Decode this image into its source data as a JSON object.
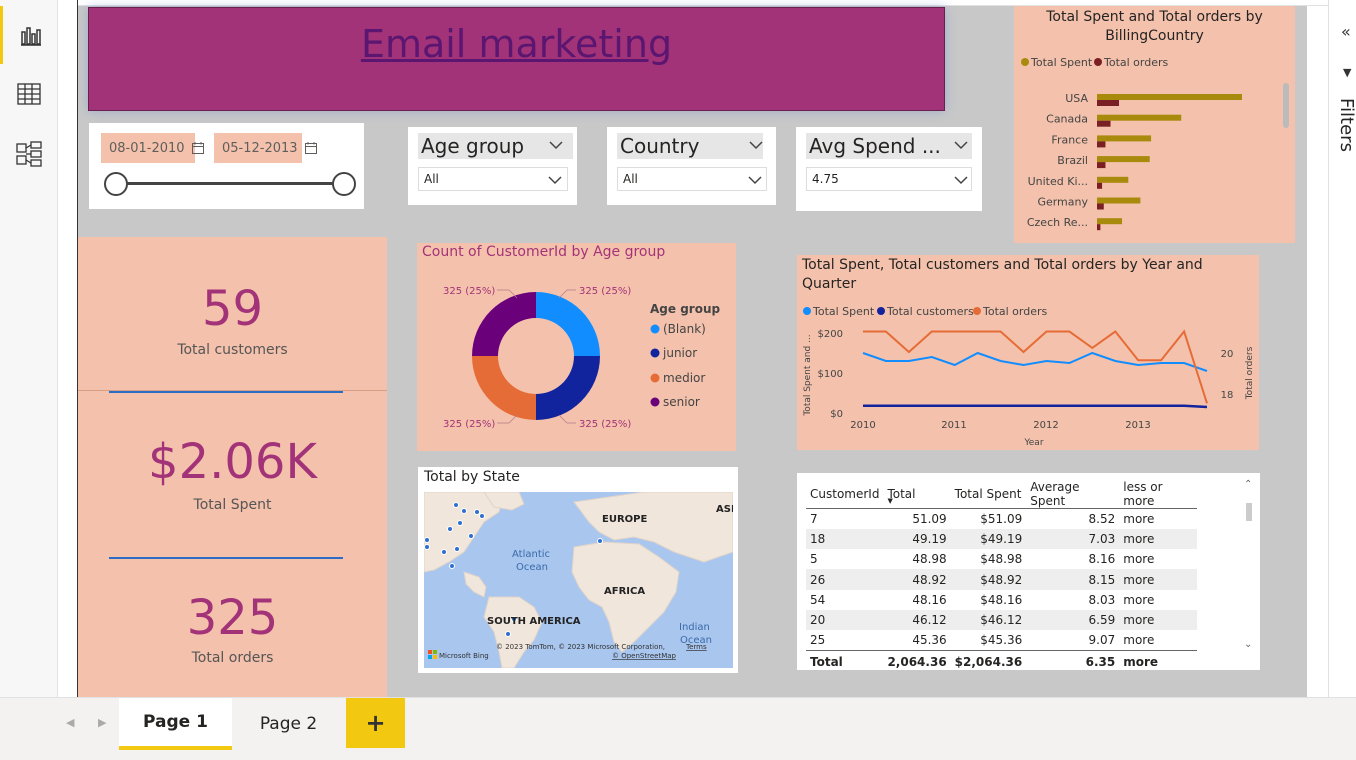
{
  "app": {
    "accent": "#f2c811",
    "canvas_bg": "#c8c8c8",
    "panel_bg": "#f4c2ac",
    "title_bg": "#a33378"
  },
  "left_rail": {
    "items": [
      "report-view-icon",
      "table-view-icon",
      "model-view-icon"
    ]
  },
  "title": {
    "text": "Email marketing "
  },
  "date_slicer": {
    "start": "08-01-2010",
    "end": "05-12-2013"
  },
  "slicers": [
    {
      "header": "Age group",
      "value": "All"
    },
    {
      "header": "Country",
      "value": "All"
    },
    {
      "header": "Avg Spend ...",
      "value": "4.75"
    }
  ],
  "kpis": [
    {
      "value": "59",
      "label": "Total customers"
    },
    {
      "value": "$2.06K",
      "label": "Total Spent"
    },
    {
      "value": "325",
      "label": "Total orders"
    }
  ],
  "donut": {
    "title": "Count of CustomerId by Age group",
    "legend_title": "Age group",
    "slice_labels": [
      "325 (25%)",
      "325 (25%)",
      "325 (25%)",
      "325 (25%)"
    ],
    "legend": [
      "(Blank)",
      "junior",
      "medior",
      "senior"
    ]
  },
  "map": {
    "title": "Total by State",
    "labels": [
      "EUROPE",
      "ASI",
      "Atlantic",
      "Ocean",
      "AFRICA",
      "SOUTH AMERICA",
      "Indian",
      "Ocean"
    ],
    "brand": "Microsoft Bing",
    "copyright": "© 2023 TomTom, © 2023 Microsoft Corporation,",
    "terms": "Terms",
    "osm": "© OpenStreetMap"
  },
  "line_chart_title": "Total Spent, Total customers and Total orders by Year and Quarter",
  "bar_chart_title": "Total Spent and Total orders by BillingCountry",
  "chart_data": [
    {
      "type": "bar",
      "title": "Total Spent and Total orders by BillingCountry",
      "categories": [
        "USA",
        "Canada",
        "France",
        "Brazil",
        "United Ki...",
        "Germany",
        "Czech Re..."
      ],
      "series": [
        {
          "name": "Total Spent",
          "values": [
            523.06,
            303.96,
            195.1,
            190.1,
            112.86,
            156.48,
            90.24
          ]
        },
        {
          "name": "Total orders",
          "values": [
            91,
            56,
            35,
            35,
            21,
            28,
            14
          ]
        }
      ],
      "colors": [
        "#a88a0c",
        "#7a1f23"
      ]
    },
    {
      "type": "pie",
      "title": "Count of CustomerId by Age group",
      "categories": [
        "(Blank)",
        "junior",
        "medior",
        "senior"
      ],
      "values": [
        325,
        325,
        325,
        325
      ],
      "colors": [
        "#118dff",
        "#12239e",
        "#e66c37",
        "#6b007b"
      ]
    },
    {
      "type": "line",
      "title": "Total Spent, Total customers and Total orders by Year and Quarter",
      "x": [
        "2010 Q1",
        "2010 Q2",
        "2010 Q3",
        "2010 Q4",
        "2011 Q1",
        "2011 Q2",
        "2011 Q3",
        "2011 Q4",
        "2012 Q1",
        "2012 Q2",
        "2012 Q3",
        "2012 Q4",
        "2013 Q1",
        "2013 Q2",
        "2013 Q3",
        "2013 Q4"
      ],
      "x_ticks": [
        "2010",
        "2011",
        "2012",
        "2013"
      ],
      "xlabel": "Year",
      "ylabel": "Total Spent and ...",
      "y2label": "Total orders",
      "y_ticks": [
        "$200",
        "$100",
        "$0"
      ],
      "y2_ticks": [
        "20",
        "18"
      ],
      "series": [
        {
          "name": "Total Spent",
          "axis": "left",
          "values": [
            150,
            130,
            130,
            140,
            120,
            150,
            130,
            120,
            130,
            125,
            150,
            130,
            120,
            125,
            125,
            105
          ]
        },
        {
          "name": "Total customers",
          "axis": "left",
          "values": [
            18,
            18,
            18,
            18,
            18,
            18,
            18,
            18,
            18,
            18,
            18,
            18,
            18,
            18,
            18,
            15
          ]
        },
        {
          "name": "Total orders",
          "axis": "right",
          "values": [
            21,
            21,
            20,
            21,
            21,
            21,
            21,
            20,
            21,
            21,
            20.2,
            21,
            19.6,
            19.6,
            21,
            17.5
          ]
        }
      ],
      "colors": [
        "#118dff",
        "#12239e",
        "#e66c37"
      ]
    }
  ],
  "table": {
    "headers": [
      "CustomerId",
      "Total",
      "Total Spent",
      "Average Spent",
      "less or more"
    ],
    "rows": [
      [
        "7",
        "51.09",
        "$51.09",
        "8.52",
        "more"
      ],
      [
        "18",
        "49.19",
        "$49.19",
        "7.03",
        "more"
      ],
      [
        "5",
        "48.98",
        "$48.98",
        "8.16",
        "more"
      ],
      [
        "26",
        "48.92",
        "$48.92",
        "8.15",
        "more"
      ],
      [
        "54",
        "48.16",
        "$48.16",
        "8.03",
        "more"
      ],
      [
        "20",
        "46.12",
        "$46.12",
        "6.59",
        "more"
      ],
      [
        "25",
        "45.36",
        "$45.36",
        "9.07",
        "more"
      ]
    ],
    "total": [
      "Total",
      "2,064.36",
      "$2,064.36",
      "6.35",
      "more"
    ]
  },
  "pages": {
    "tabs": [
      "Page 1",
      "Page 2"
    ],
    "add_label": "+"
  },
  "filters_pane": {
    "label": "Filters"
  }
}
